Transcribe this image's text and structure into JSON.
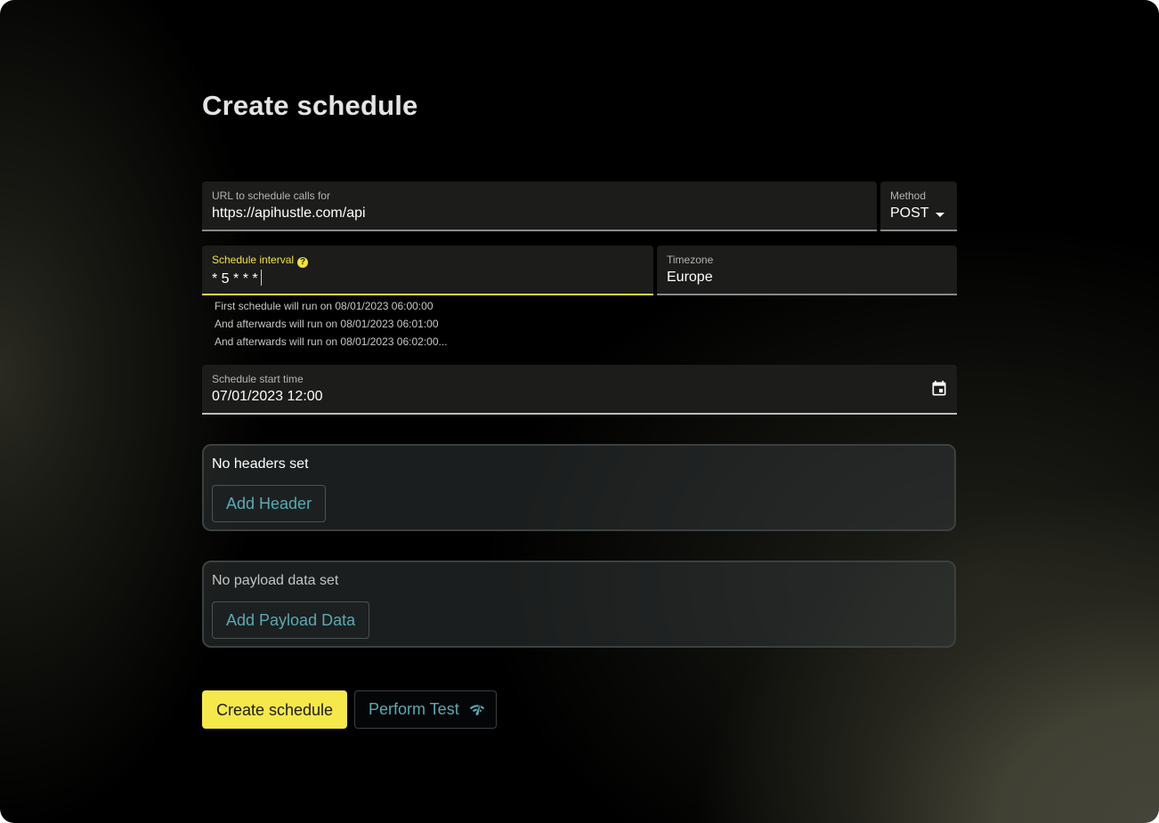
{
  "page": {
    "title": "Create schedule"
  },
  "form": {
    "url": {
      "label": "URL to schedule calls for",
      "value": "https://apihustle.com/api"
    },
    "method": {
      "label": "Method",
      "value": "POST"
    },
    "interval": {
      "label": "Schedule interval",
      "value": "* 5 * * *",
      "help_icon": "?"
    },
    "timezone": {
      "label": "Timezone",
      "value": "Europe"
    },
    "interval_hints": [
      "First schedule will run on 08/01/2023 06:00:00",
      "And afterwards will run on 08/01/2023 06:01:00",
      "And afterwards will run on 08/01/2023 06:02:00..."
    ],
    "start_time": {
      "label": "Schedule start time",
      "value": "07/01/2023 12:00"
    }
  },
  "headers": {
    "empty_text": "No headers set",
    "add_label": "Add Header"
  },
  "payload": {
    "empty_text": "No payload data set",
    "add_label": "Add Payload Data"
  },
  "actions": {
    "create_label": "Create schedule",
    "test_label": "Perform Test"
  },
  "colors": {
    "accent_yellow": "#f5e84a",
    "accent_teal": "#5aaab5"
  }
}
